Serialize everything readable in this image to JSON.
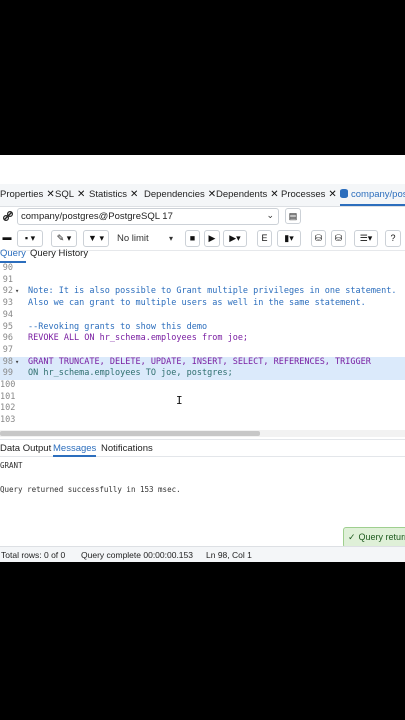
{
  "tabs": [
    {
      "label": "Properties"
    },
    {
      "label": "SQL"
    },
    {
      "label": "Statistics"
    },
    {
      "label": "Dependencies"
    },
    {
      "label": "Dependents"
    },
    {
      "label": "Processes"
    },
    {
      "label": "company/postgres"
    }
  ],
  "connection": {
    "value": "company/postgres@PostgreSQL 17"
  },
  "toolbar": {
    "limit": "No limit"
  },
  "query_tabs": [
    "Query",
    "Query History"
  ],
  "editor": {
    "lines": [
      {
        "n": "90",
        "code": ""
      },
      {
        "n": "91",
        "code": ""
      },
      {
        "n": "92",
        "code": "Note: It is also possible to Grant multiple privileges in one statement."
      },
      {
        "n": "93",
        "code": "Also we can grant to multiple users as well in the same statement."
      },
      {
        "n": "94",
        "code": ""
      },
      {
        "n": "95",
        "code": "--Revoking grants to show this demo"
      },
      {
        "n": "96",
        "code": "REVOKE ALL ON hr_schema.employees from joe;"
      },
      {
        "n": "97",
        "code": ""
      },
      {
        "n": "98",
        "code": "GRANT TRUNCATE, DELETE, UPDATE, INSERT, SELECT, REFERENCES, TRIGGER"
      },
      {
        "n": "99",
        "code": "ON hr_schema.employees TO joe, postgres;"
      },
      {
        "n": "100",
        "code": ""
      },
      {
        "n": "101",
        "code": ""
      },
      {
        "n": "102",
        "code": ""
      },
      {
        "n": "103",
        "code": ""
      }
    ]
  },
  "result_tabs": [
    "Data Output",
    "Messages",
    "Notifications"
  ],
  "messages": {
    "line1": "GRANT",
    "line2": "Query returned successfully in 153 msec."
  },
  "toast": {
    "text": "Query returned successfully"
  },
  "status": {
    "rows": "Total rows: 0 of 0",
    "complete": "Query complete 00:00:00.153",
    "position": "Ln 98, Col 1"
  }
}
